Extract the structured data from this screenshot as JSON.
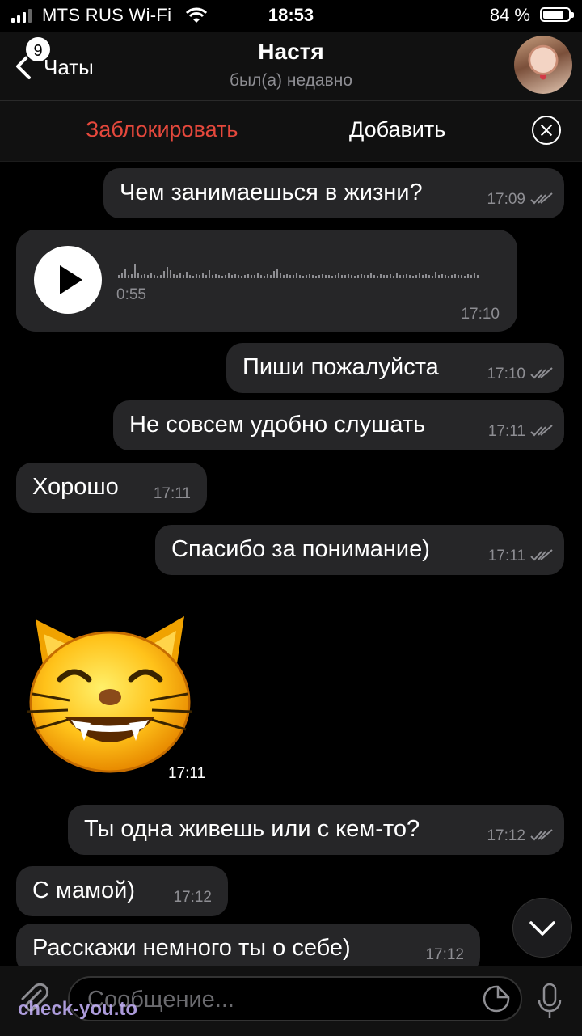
{
  "status_bar": {
    "carrier": "MTS RUS Wi-Fi",
    "time": "18:53",
    "battery_pct": "84 %",
    "battery_level": 0.84,
    "icons": [
      "signal-icon",
      "wifi-icon",
      "battery-icon"
    ]
  },
  "header": {
    "back_label": "Чаты",
    "unread_badge": "9",
    "contact_name": "Настя",
    "contact_status": "был(а) недавно"
  },
  "action_bar": {
    "block_label": "Заблокировать",
    "add_label": "Добавить",
    "block_color": "#e5483c"
  },
  "messages": [
    {
      "dir": "out",
      "text": "Чем занимаешься в жизни?",
      "time": "17:09"
    },
    {
      "dir": "in",
      "type": "voice",
      "duration": "0:55",
      "time": "17:10"
    },
    {
      "dir": "out",
      "text": "Пиши пожалуйста",
      "time": "17:10"
    },
    {
      "dir": "out",
      "text": "Не совсем удобно слушать",
      "time": "17:11"
    },
    {
      "dir": "in",
      "text": "Хорошо",
      "time": "17:11"
    },
    {
      "dir": "out",
      "text": "Спасибо за понимание)",
      "time": "17:11"
    },
    {
      "dir": "in",
      "type": "sticker",
      "sticker": "grinning-cat-emoji",
      "time": "17:11"
    },
    {
      "dir": "out",
      "text": "Ты одна живешь или с кем-то?",
      "time": "17:12"
    },
    {
      "dir": "in",
      "text": "С мамой)",
      "time": "17:12"
    },
    {
      "dir": "in",
      "text": "Расскажи немного ты о себе)",
      "time": "17:12"
    }
  ],
  "input": {
    "placeholder": "Сообщение..."
  },
  "watermark": "check-you.to"
}
